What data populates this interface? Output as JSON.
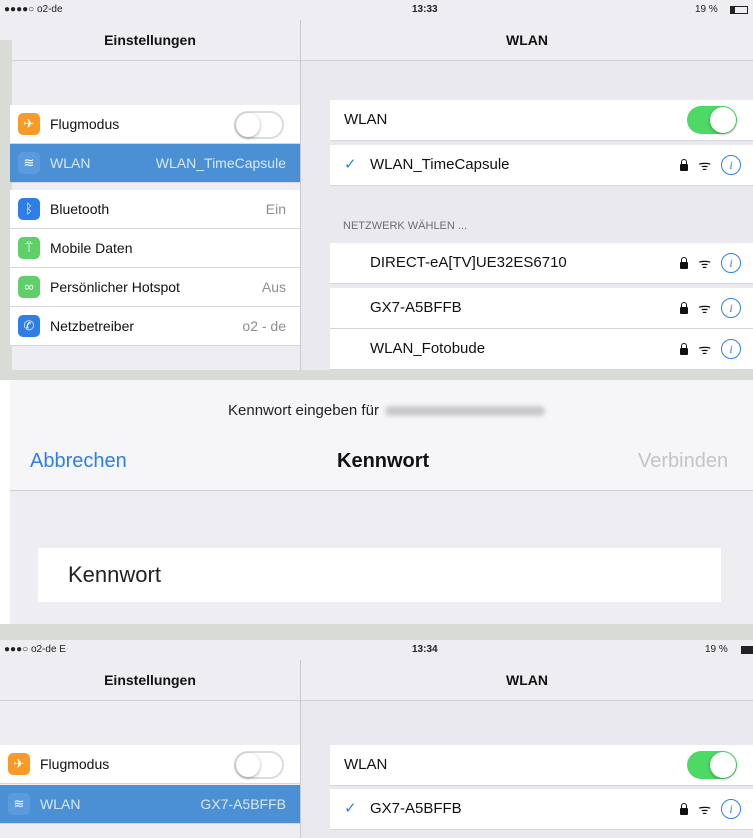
{
  "top": {
    "status": {
      "carrier": "●●●●○ o2-de",
      "time": "13:33",
      "battery": "19 %"
    },
    "left_title": "Einstellungen",
    "right_title": "WLAN",
    "sidebar": [
      {
        "label": "Flugmodus",
        "value": "",
        "icon": "airplane-icon",
        "color": "#f79a28",
        "toggle": "off"
      },
      {
        "label": "WLAN",
        "value": "WLAN_TimeCapsule",
        "icon": "wifi-icon",
        "color": "#4b8fd4",
        "selected": true
      },
      {
        "label": "Bluetooth",
        "value": "Ein",
        "icon": "bluetooth-icon",
        "color": "#2e7ee6"
      },
      {
        "label": "Mobile Daten",
        "value": "",
        "icon": "antenna-icon",
        "color": "#5fcf6a"
      },
      {
        "label": "Persönlicher Hotspot",
        "value": "Aus",
        "icon": "hotspot-icon",
        "color": "#5fcf6a"
      },
      {
        "label": "Netzbetreiber",
        "value": "o2 - de",
        "icon": "phone-icon",
        "color": "#2e7ee6"
      }
    ],
    "wlan_label": "WLAN",
    "connected": "WLAN_TimeCapsule",
    "section_label": "NETZWERK WÄHLEN ...",
    "networks": [
      "DIRECT-eA[TV]UE32ES6710",
      "GX7-A5BFFB",
      "WLAN_Fotobude"
    ]
  },
  "dialog": {
    "prompt": "Kennwort eingeben für",
    "cancel": "Abbrechen",
    "title": "Kennwort",
    "connect": "Verbinden",
    "field_placeholder": "Kennwort"
  },
  "bottom": {
    "status": {
      "carrier": "●●●○ o2-de E",
      "time": "13:34",
      "battery": "19 %"
    },
    "left_title": "Einstellungen",
    "right_title": "WLAN",
    "sidebar": [
      {
        "label": "Flugmodus",
        "value": ""
      },
      {
        "label": "WLAN",
        "value": "GX7-A5BFFB"
      }
    ],
    "wlan_label": "WLAN",
    "connected": "GX7-A5BFFB"
  },
  "colors": {
    "accent": "#2e7ee6",
    "toggle_on": "#4cd964",
    "selected_row": "#4b8fd4"
  }
}
